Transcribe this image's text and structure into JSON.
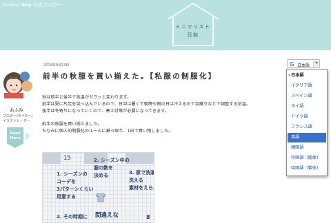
{
  "header": {
    "brand_part1": "livedoor",
    "brand_part2": "Blog",
    "brand_part3": "公式ブロガー",
    "site_title_line1": "ミニマリスト",
    "site_title_line2": "日和",
    "bg_color": "#b9e1df"
  },
  "profile": {
    "name": "おふみ",
    "role": "ブロガー/ライター/イラストレーター",
    "read_more": "Read More"
  },
  "post": {
    "date": "2019年9月23日",
    "title": "前半の秋服を買い揃えた。【私服の制服化】",
    "paragraphs": [
      "秋は前半と後半で気温がガラッと変わります。",
      "前半は夏に片足を突っ込んでいるので、日中は暑くて朝晩や雨の日は冷えるので羽織りなどで調整する気温。",
      "後半は冬寄りになっていくので、寒さ対策が必要になってきます。",
      "前半の秋服を買い揃えました。",
      "ちなみに個人的制服化のルールに乗っ取り、1日で買い物しました。"
    ]
  },
  "notebook": {
    "page_number": "15",
    "col1_line1": "1. シーズンの",
    "col1_line2": "コーデを",
    "col1_line3": "3パターンくらい",
    "col1_line4": "用意する",
    "col1_bottom": "2. その時期に",
    "col2_line1": "2. シーズン中の",
    "col2_line2": "服の数を",
    "col2_line3": "決める",
    "col2_bottom": "間違えな",
    "col3_line1": "3. 家で洗濯",
    "col3_line2": "洗える",
    "col3_line3": "素材をえらぶ",
    "col3_bottom": "8"
  },
  "translate": {
    "label": "日本語",
    "icon": "google-g-icon",
    "options": [
      "日本語",
      "イタリア語",
      "スペイン語",
      "タイ語",
      "ドイツ語",
      "フランス語",
      "英語",
      "韓国語",
      "中国語（簡体）",
      "中国語（繁体）"
    ],
    "current": "日本語",
    "highlighted": "英語",
    "highlight_color": "#3c6fc8"
  }
}
